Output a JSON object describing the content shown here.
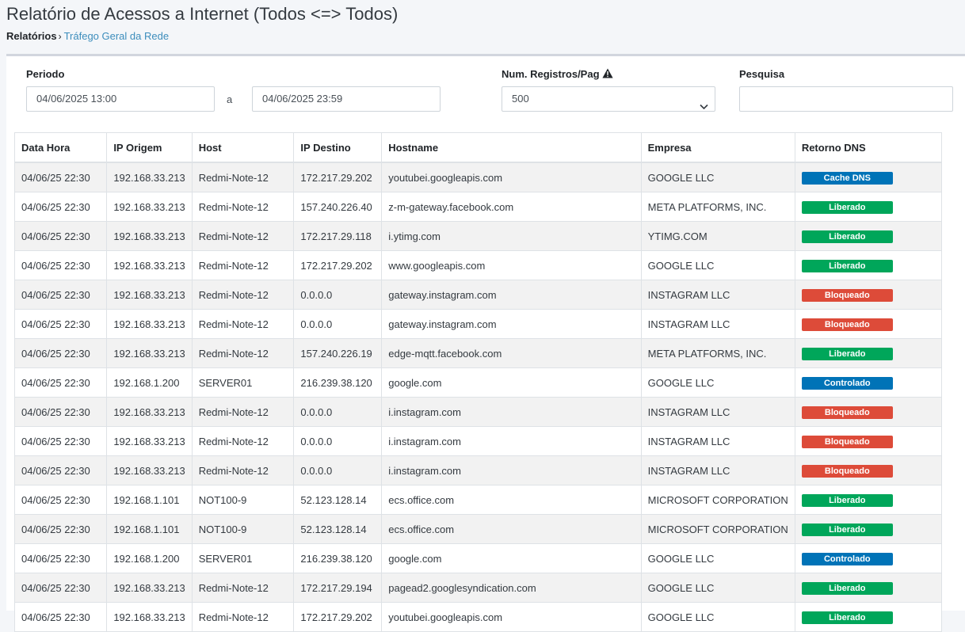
{
  "page": {
    "title": "Relatório de Acessos a Internet (Todos <=> Todos)",
    "breadcrumb_root": "Relatórios",
    "breadcrumb_sep": "›",
    "breadcrumb_link": "Tráfego Geral da Rede"
  },
  "filters": {
    "periodo_label": "Periodo",
    "date_from": "04/06/2025 13:00",
    "date_sep": "a",
    "date_to": "04/06/2025 23:59",
    "registros_label": "Num. Registros/Pag",
    "registros_value": "500",
    "pesquisa_label": "Pesquisa",
    "pesquisa_value": ""
  },
  "table": {
    "columns": [
      "Data Hora",
      "IP Origem",
      "Host",
      "IP Destino",
      "Hostname",
      "Empresa",
      "Retorno DNS"
    ],
    "rows": [
      {
        "dt": "04/06/25 22:30",
        "src": "192.168.33.213",
        "host": "Redmi-Note-12",
        "dst": "172.217.29.202",
        "hostname": "youtubei.googleapis.com",
        "empresa": "GOOGLE LLC",
        "dns": "Cache DNS",
        "status": "cache"
      },
      {
        "dt": "04/06/25 22:30",
        "src": "192.168.33.213",
        "host": "Redmi-Note-12",
        "dst": "157.240.226.40",
        "hostname": "z-m-gateway.facebook.com",
        "empresa": "META PLATFORMS, INC.",
        "dns": "Liberado",
        "status": "lib"
      },
      {
        "dt": "04/06/25 22:30",
        "src": "192.168.33.213",
        "host": "Redmi-Note-12",
        "dst": "172.217.29.118",
        "hostname": "i.ytimg.com",
        "empresa": "YTIMG.COM",
        "dns": "Liberado",
        "status": "lib"
      },
      {
        "dt": "04/06/25 22:30",
        "src": "192.168.33.213",
        "host": "Redmi-Note-12",
        "dst": "172.217.29.202",
        "hostname": "www.googleapis.com",
        "empresa": "GOOGLE LLC",
        "dns": "Liberado",
        "status": "lib"
      },
      {
        "dt": "04/06/25 22:30",
        "src": "192.168.33.213",
        "host": "Redmi-Note-12",
        "dst": "0.0.0.0",
        "hostname": "gateway.instagram.com",
        "empresa": "INSTAGRAM LLC",
        "dns": "Bloqueado",
        "status": "blo"
      },
      {
        "dt": "04/06/25 22:30",
        "src": "192.168.33.213",
        "host": "Redmi-Note-12",
        "dst": "0.0.0.0",
        "hostname": "gateway.instagram.com",
        "empresa": "INSTAGRAM LLC",
        "dns": "Bloqueado",
        "status": "blo"
      },
      {
        "dt": "04/06/25 22:30",
        "src": "192.168.33.213",
        "host": "Redmi-Note-12",
        "dst": "157.240.226.19",
        "hostname": "edge-mqtt.facebook.com",
        "empresa": "META PLATFORMS, INC.",
        "dns": "Liberado",
        "status": "lib"
      },
      {
        "dt": "04/06/25 22:30",
        "src": "192.168.1.200",
        "host": "SERVER01",
        "dst": "216.239.38.120",
        "hostname": "google.com",
        "empresa": "GOOGLE LLC",
        "dns": "Controlado",
        "status": "ctl"
      },
      {
        "dt": "04/06/25 22:30",
        "src": "192.168.33.213",
        "host": "Redmi-Note-12",
        "dst": "0.0.0.0",
        "hostname": "i.instagram.com",
        "empresa": "INSTAGRAM LLC",
        "dns": "Bloqueado",
        "status": "blo"
      },
      {
        "dt": "04/06/25 22:30",
        "src": "192.168.33.213",
        "host": "Redmi-Note-12",
        "dst": "0.0.0.0",
        "hostname": "i.instagram.com",
        "empresa": "INSTAGRAM LLC",
        "dns": "Bloqueado",
        "status": "blo"
      },
      {
        "dt": "04/06/25 22:30",
        "src": "192.168.33.213",
        "host": "Redmi-Note-12",
        "dst": "0.0.0.0",
        "hostname": "i.instagram.com",
        "empresa": "INSTAGRAM LLC",
        "dns": "Bloqueado",
        "status": "blo"
      },
      {
        "dt": "04/06/25 22:30",
        "src": "192.168.1.101",
        "host": "NOT100-9",
        "dst": "52.123.128.14",
        "hostname": "ecs.office.com",
        "empresa": "MICROSOFT CORPORATION",
        "dns": "Liberado",
        "status": "lib"
      },
      {
        "dt": "04/06/25 22:30",
        "src": "192.168.1.101",
        "host": "NOT100-9",
        "dst": "52.123.128.14",
        "hostname": "ecs.office.com",
        "empresa": "MICROSOFT CORPORATION",
        "dns": "Liberado",
        "status": "lib"
      },
      {
        "dt": "04/06/25 22:30",
        "src": "192.168.1.200",
        "host": "SERVER01",
        "dst": "216.239.38.120",
        "hostname": "google.com",
        "empresa": "GOOGLE LLC",
        "dns": "Controlado",
        "status": "ctl"
      },
      {
        "dt": "04/06/25 22:30",
        "src": "192.168.33.213",
        "host": "Redmi-Note-12",
        "dst": "172.217.29.194",
        "hostname": "pagead2.googlesyndication.com",
        "empresa": "GOOGLE LLC",
        "dns": "Liberado",
        "status": "lib"
      },
      {
        "dt": "04/06/25 22:30",
        "src": "192.168.33.213",
        "host": "Redmi-Note-12",
        "dst": "172.217.29.202",
        "hostname": "youtubei.googleapis.com",
        "empresa": "GOOGLE LLC",
        "dns": "Liberado",
        "status": "lib"
      }
    ]
  },
  "colors": {
    "cache": "#0073b7",
    "liberado": "#00a65a",
    "bloqueado": "#dd4b39",
    "controlado": "#0073b7",
    "link": "#3c8dbc"
  }
}
